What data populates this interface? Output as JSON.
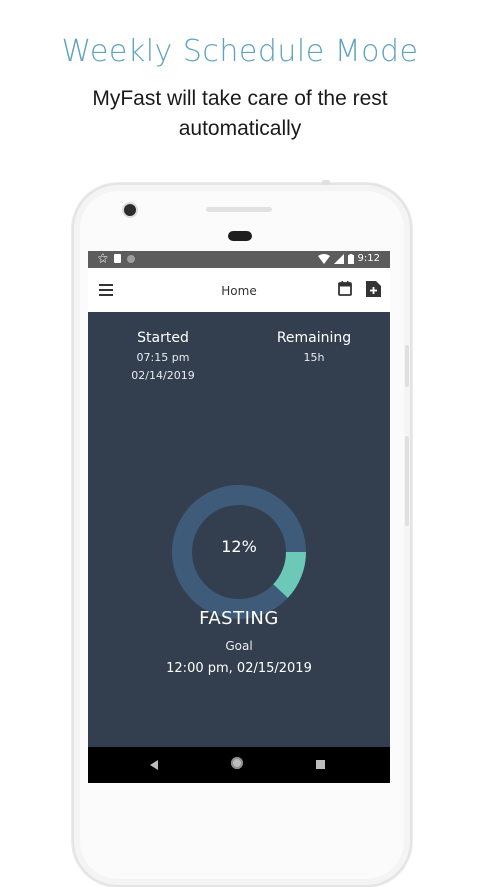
{
  "promo": {
    "title": "Weekly Schedule Mode",
    "subtitle": "MyFast will take care of the rest automatically"
  },
  "statusbar": {
    "time": "9:12",
    "left_icons": [
      "notification-icon",
      "sim-icon",
      "circle-icon"
    ],
    "right_icons": [
      "wifi-icon",
      "signal-icon",
      "battery-icon"
    ]
  },
  "appbar": {
    "title": "Home",
    "icons": [
      "menu-icon",
      "calendar-icon",
      "add-note-icon"
    ]
  },
  "started": {
    "label": "Started",
    "time": "07:15 pm",
    "date": "02/14/2019"
  },
  "remaining": {
    "label": "Remaining",
    "value": "15h"
  },
  "progress": {
    "percent_text": "12%",
    "fraction": 0.12
  },
  "status": {
    "state": "FASTING",
    "goal_label": "Goal",
    "goal_value": "12:00 pm, 02/15/2019"
  },
  "colors": {
    "accent": "#5fa3bf",
    "screen_bg": "#333f4f",
    "ring_track": "#3f5b7a",
    "ring_fill": "#6cc9b8"
  },
  "navbar": {
    "icons": [
      "back-icon",
      "home-icon",
      "recents-icon"
    ]
  }
}
